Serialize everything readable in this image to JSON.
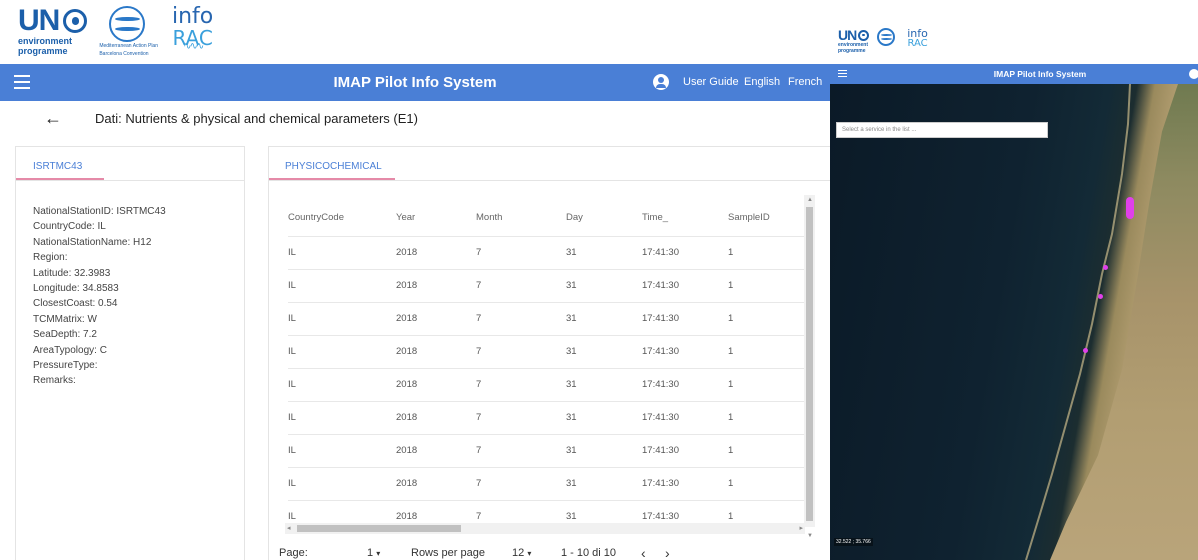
{
  "left_app": {
    "logos": {
      "un": "UN",
      "un_sub1": "environment",
      "un_sub2": "programme",
      "map_sub1": "Mediterranean Action Plan",
      "map_sub2": "Barcelona Convention",
      "info": "info",
      "rac": "RAC"
    },
    "header": {
      "title": "IMAP Pilot Info System",
      "user_guide": "User Guide",
      "lang_en": "English",
      "lang_fr": "French"
    },
    "page": {
      "title": "Dati: Nutrients & physical and chemical parameters (E1)"
    },
    "station": {
      "tab": "ISRTMC43",
      "props": [
        "NationalStationID: ISRTMC43",
        "CountryCode: IL",
        "NationalStationName: H12",
        "Region:",
        "Latitude: 32.3983",
        "Longitude: 34.8583",
        "ClosestCoast: 0.54",
        "TCMMatrix: W",
        "SeaDepth: 7.2",
        "AreaTypology: C",
        "PressureType:",
        "Remarks:"
      ]
    },
    "data_table": {
      "tab": "PHYSICOCHEMICAL",
      "columns": [
        "CountryCode",
        "Year",
        "Month",
        "Day",
        "Time_",
        "SampleID"
      ],
      "rows": [
        [
          "IL",
          "2018",
          "7",
          "31",
          "17:41:30",
          "1"
        ],
        [
          "IL",
          "2018",
          "7",
          "31",
          "17:41:30",
          "1"
        ],
        [
          "IL",
          "2018",
          "7",
          "31",
          "17:41:30",
          "1"
        ],
        [
          "IL",
          "2018",
          "7",
          "31",
          "17:41:30",
          "1"
        ],
        [
          "IL",
          "2018",
          "7",
          "31",
          "17:41:30",
          "1"
        ],
        [
          "IL",
          "2018",
          "7",
          "31",
          "17:41:30",
          "1"
        ],
        [
          "IL",
          "2018",
          "7",
          "31",
          "17:41:30",
          "1"
        ],
        [
          "IL",
          "2018",
          "7",
          "31",
          "17:41:30",
          "1"
        ],
        [
          "IL",
          "2018",
          "7",
          "31",
          "17:41:30",
          "1"
        ]
      ]
    },
    "pager": {
      "page_label": "Page:",
      "page_value": "1",
      "rows_label": "Rows per page",
      "rows_value": "12",
      "range": "1 - 10 di 10",
      "prev": "‹",
      "next": "›",
      "dropdown": "▾"
    }
  },
  "right_app": {
    "header": {
      "title": "IMAP Pilot Info System"
    },
    "service_placeholder": "Select a service in the list ...",
    "coords": "32.522 ; 35.766",
    "colors": {
      "marker": "#e040ea",
      "appbar": "#4a7fd6"
    }
  },
  "colors": {
    "accent": "#4a7fd6",
    "tab_underline": "#e58aa8"
  }
}
